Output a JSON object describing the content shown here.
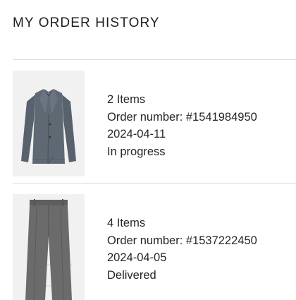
{
  "header": {
    "title": "MY ORDER HISTORY"
  },
  "orders": [
    {
      "items": "2 Items",
      "order_number": "Order number: #1541984950",
      "date": "2024-04-11",
      "status": "In progress",
      "image_icon": "knit-blazer-image"
    },
    {
      "items": "4 Items",
      "order_number": "Order number: #1537222450",
      "date": "2024-04-05",
      "status": "Delivered",
      "image_icon": "wool-trousers-image"
    }
  ],
  "colors": {
    "blazer": "#5c6670",
    "trousers": "#6a6a6a",
    "thumb_bg": "#f1f1f1",
    "divider": "#dddddd"
  }
}
